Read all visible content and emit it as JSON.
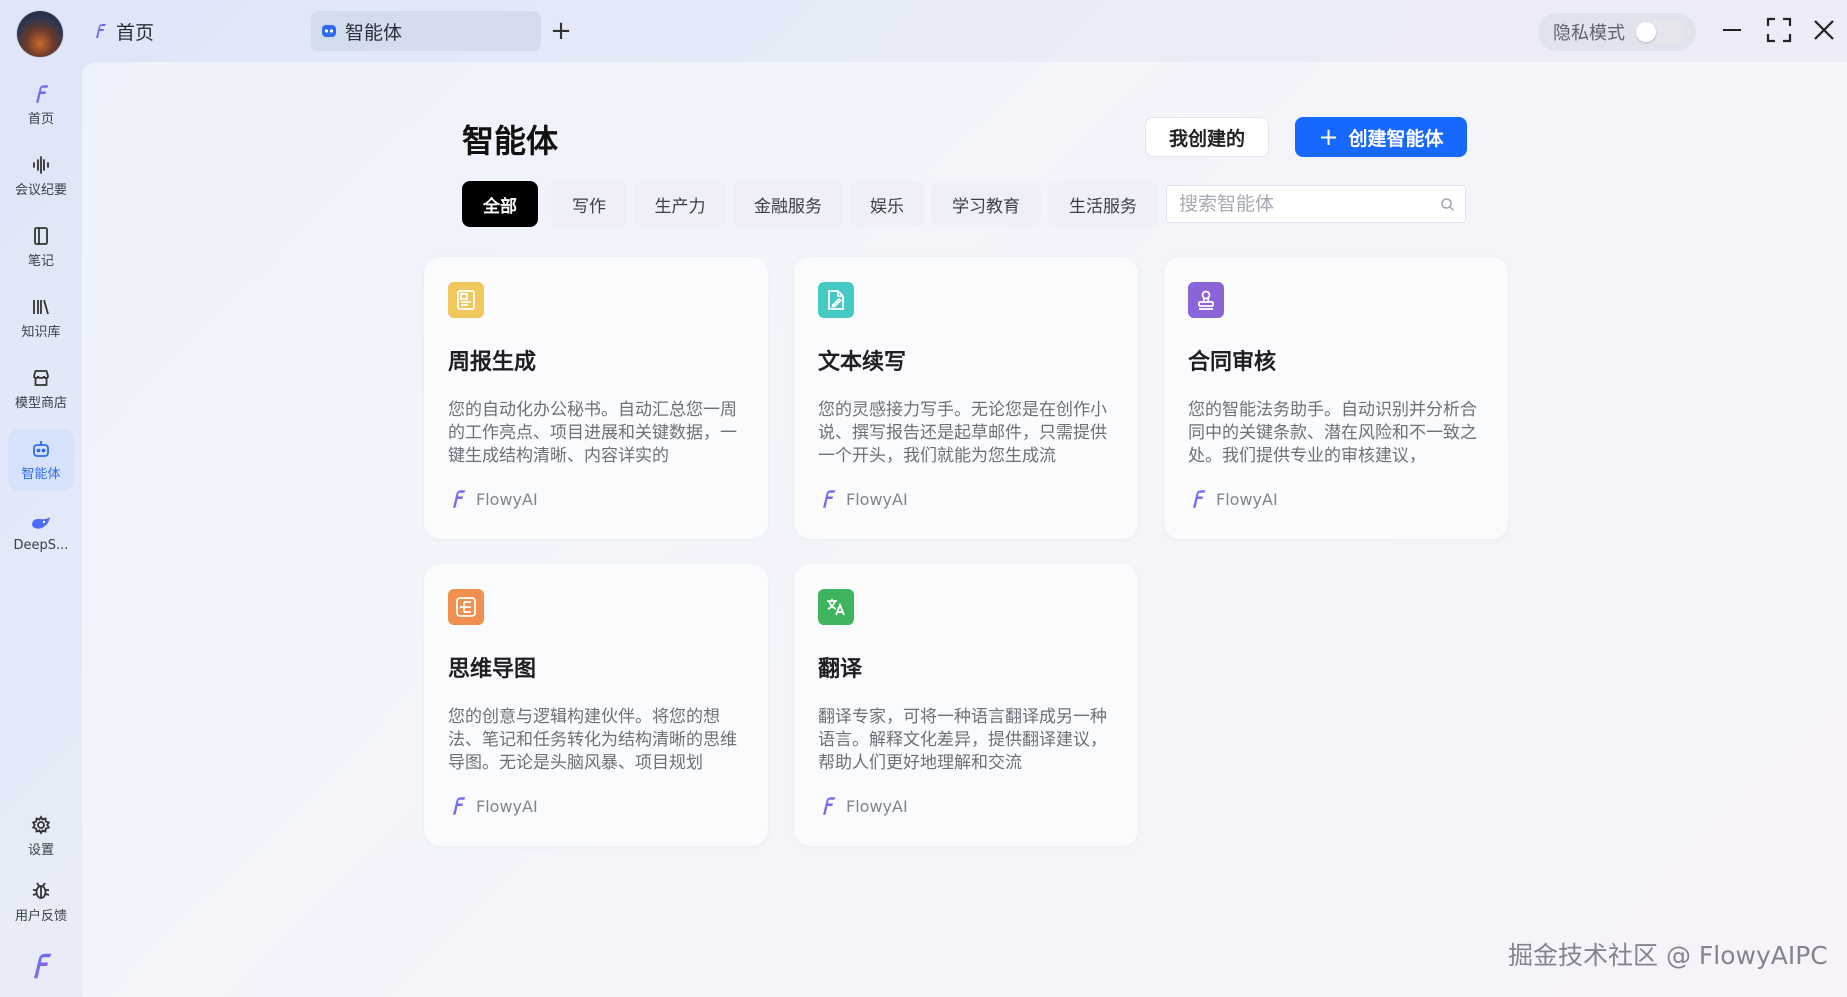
{
  "titlebar": {
    "tabs": [
      {
        "label": "首页"
      },
      {
        "label": "智能体"
      }
    ],
    "add_tab": "+",
    "privacy_label": "隐私模式",
    "privacy_on": false
  },
  "sidebar": {
    "items": [
      {
        "label": "首页"
      },
      {
        "label": "会议纪要"
      },
      {
        "label": "笔记"
      },
      {
        "label": "知识库"
      },
      {
        "label": "模型商店"
      },
      {
        "label": "智能体"
      },
      {
        "label": "DeepS..."
      },
      {
        "label": "设置"
      },
      {
        "label": "用户反馈"
      }
    ],
    "active": "智能体"
  },
  "main": {
    "title": "智能体",
    "mine_button": "我创建的",
    "create_button": "创建智能体",
    "categories": [
      "全部",
      "写作",
      "生产力",
      "金融服务",
      "娱乐",
      "学习教育",
      "生活服务"
    ],
    "active_category": "全部",
    "search_placeholder": "搜索智能体",
    "cards": [
      {
        "title": "周报生成",
        "desc": "您的自动化办公秘书。自动汇总您一周的工作亮点、项目进展和关键数据，一键生成结构清晰、内容详实的",
        "author": "FlowyAI"
      },
      {
        "title": "文本续写",
        "desc": "您的灵感接力写手。无论您是在创作小说、撰写报告还是起草邮件，只需提供一个开头，我们就能为您生成流",
        "author": "FlowyAI"
      },
      {
        "title": "合同审核",
        "desc": "您的智能法务助手。自动识别并分析合同中的关键条款、潜在风险和不一致之处。我们提供专业的审核建议，",
        "author": "FlowyAI"
      },
      {
        "title": "思维导图",
        "desc": "您的创意与逻辑构建伙伴。将您的想法、笔记和任务转化为结构清晰的思维导图。无论是头脑风暴、项目规划",
        "author": "FlowyAI"
      },
      {
        "title": "翻译",
        "desc": "翻译专家，可将一种语言翻译成另一种语言。解释文化差异，提供翻译建议，帮助人们更好地理解和交流",
        "author": "FlowyAI"
      }
    ]
  },
  "watermark": "掘金技术社区 @ FlowyAIPC",
  "colors": {
    "accent": "#1668ff",
    "active_side": "#2e6bef",
    "icon_weekly": "#f0c259",
    "icon_continue": "#3cc6c4",
    "icon_contract": "#8b63d8",
    "icon_mindmap": "#f08c4a",
    "icon_translate": "#3db35f"
  }
}
